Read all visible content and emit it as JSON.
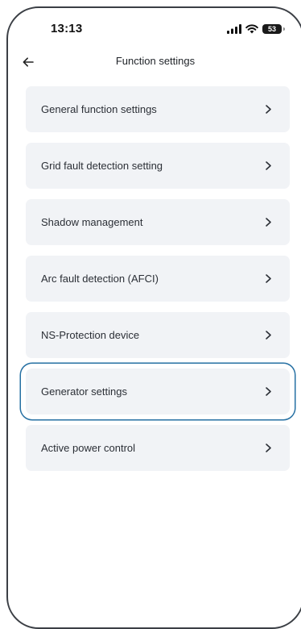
{
  "status_bar": {
    "time": "13:13",
    "battery": "53",
    "icons": [
      "signal-icon",
      "wifi-icon",
      "battery-icon"
    ]
  },
  "header": {
    "title": "Function settings",
    "back_icon": "arrow-left-icon"
  },
  "menu": {
    "chevron_icon": "chevron-right-icon",
    "highlight_color": "#2670a3",
    "items": [
      {
        "label": "General function settings"
      },
      {
        "label": "Grid fault detection setting"
      },
      {
        "label": "Shadow management"
      },
      {
        "label": "Arc fault detection (AFCI)"
      },
      {
        "label": "NS-Protection device"
      },
      {
        "label": "Generator settings",
        "highlighted": true
      },
      {
        "label": "Active power control"
      }
    ]
  }
}
